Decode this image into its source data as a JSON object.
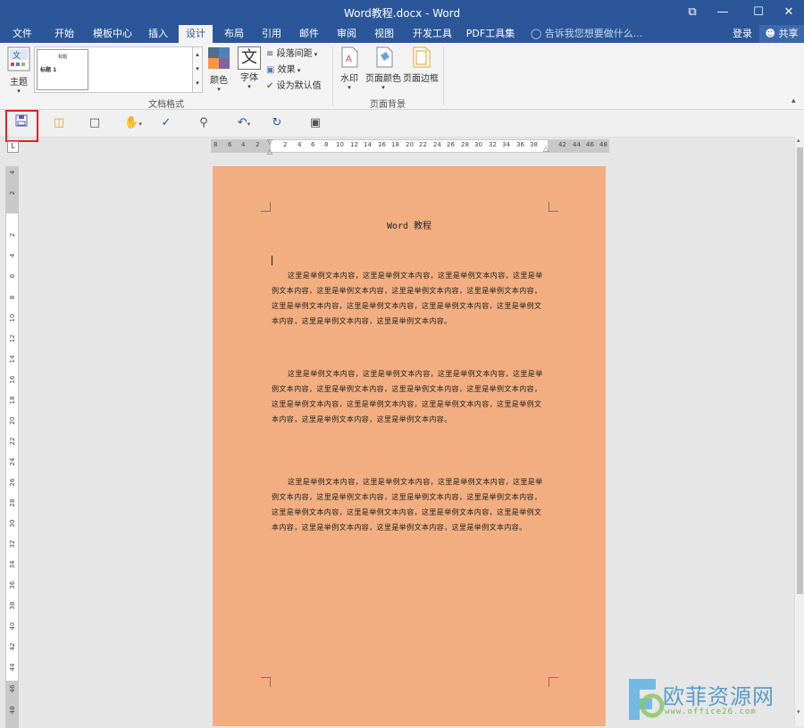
{
  "window": {
    "title": "Word教程.docx - Word",
    "btn_restore": "⧉",
    "btn_min": "—",
    "btn_max": "☐",
    "btn_close": "✕"
  },
  "tabs": [
    "文件",
    "开始",
    "模板中心",
    "插入",
    "设计",
    "布局",
    "引用",
    "邮件",
    "审阅",
    "视图",
    "开发工具",
    "PDF工具集"
  ],
  "active_tab": "设计",
  "tellme": {
    "icon": "lightbulb-icon",
    "placeholder": "告诉我您想要做什么..."
  },
  "account": {
    "login": "登录",
    "share": "共享"
  },
  "ribbon": {
    "theme_label": "主题",
    "styles_preview_title": "标题",
    "styles_preview_heading": "标题 1",
    "colors_label": "颜色",
    "fonts_label": "字体",
    "fonts_glyph": "文",
    "paragraph_spacing_label": "段落间距",
    "effects_label": "效果",
    "set_default_label": "设为默认值",
    "group_doc_format": "文档格式",
    "watermark_label": "水印",
    "page_color_label": "页面颜色",
    "page_border_label": "页面边框",
    "group_page_bg": "页面背景"
  },
  "qat": [
    "save-icon",
    "open-folder-icon",
    "new-document-icon",
    "touch-mode-icon",
    "spelling-icon",
    "print-preview-icon",
    "undo-icon",
    "redo-icon",
    "screen-icon"
  ],
  "ruler": {
    "h_ticks": [
      "8",
      "6",
      "4",
      "2",
      "2",
      "4",
      "6",
      "8",
      "10",
      "12",
      "14",
      "16",
      "18",
      "20",
      "22",
      "24",
      "26",
      "28",
      "30",
      "32",
      "34",
      "36",
      "38",
      "42",
      "44",
      "46",
      "48"
    ],
    "v_ticks": [
      "4",
      "2",
      "2",
      "4",
      "6",
      "8",
      "10",
      "12",
      "14",
      "16",
      "18",
      "20",
      "22",
      "24",
      "26",
      "28",
      "30",
      "32",
      "34",
      "36",
      "38",
      "40",
      "42",
      "44",
      "46",
      "48"
    ]
  },
  "document": {
    "title": "Word 教程",
    "paragraphs": [
      "这里是举例文本内容，这里是举例文本内容，这里是举例文本内容，这里是举例文本内容，这里是举例文本内容，这里是举例文本内容，这里是举例文本内容，这里是举例文本内容，这里是举例文本内容，这里是举例文本内容，这里是举例文本内容，这里是举例文本内容，这里是举例文本内容。",
      "这里是举例文本内容，这里是举例文本内容，这里是举例文本内容，这里是举例文本内容，这里是举例文本内容，这里是举例文本内容，这里是举例文本内容，这里是举例文本内容，这里是举例文本内容，这里是举例文本内容，这里是举例文本内容，这里是举例文本内容，这里是举例文本内容。",
      "这里是举例文本内容，这里是举例文本内容，这里是举例文本内容，这里是举例文本内容，这里是举例文本内容，这里是举例文本内容，这里是举例文本内容，这里是举例文本内容，这里是举例文本内容，这里是举例文本内容，这里是举例文本内容，这里是举例文本内容，这里是举例文本内容，这里是举例文本内容。"
    ],
    "page_color": "#f2ae80"
  },
  "watermark": {
    "text": "欧菲资源网",
    "url": "www.office26.com"
  },
  "colors": {
    "brand": "#2b579a",
    "highlight": "#e02020"
  }
}
